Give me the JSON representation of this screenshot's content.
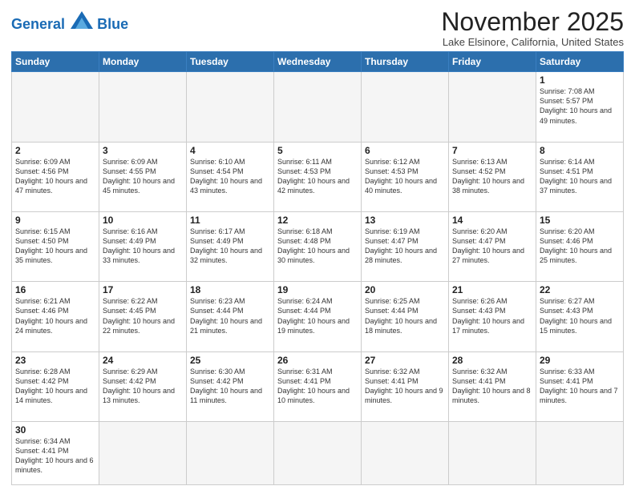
{
  "header": {
    "logo_general": "General",
    "logo_blue": "Blue",
    "month": "November 2025",
    "location": "Lake Elsinore, California, United States"
  },
  "days_of_week": [
    "Sunday",
    "Monday",
    "Tuesday",
    "Wednesday",
    "Thursday",
    "Friday",
    "Saturday"
  ],
  "weeks": [
    [
      {
        "num": "",
        "info": ""
      },
      {
        "num": "",
        "info": ""
      },
      {
        "num": "",
        "info": ""
      },
      {
        "num": "",
        "info": ""
      },
      {
        "num": "",
        "info": ""
      },
      {
        "num": "",
        "info": ""
      },
      {
        "num": "1",
        "info": "Sunrise: 7:08 AM\nSunset: 5:57 PM\nDaylight: 10 hours and 49 minutes."
      }
    ],
    [
      {
        "num": "2",
        "info": "Sunrise: 6:09 AM\nSunset: 4:56 PM\nDaylight: 10 hours and 47 minutes."
      },
      {
        "num": "3",
        "info": "Sunrise: 6:09 AM\nSunset: 4:55 PM\nDaylight: 10 hours and 45 minutes."
      },
      {
        "num": "4",
        "info": "Sunrise: 6:10 AM\nSunset: 4:54 PM\nDaylight: 10 hours and 43 minutes."
      },
      {
        "num": "5",
        "info": "Sunrise: 6:11 AM\nSunset: 4:53 PM\nDaylight: 10 hours and 42 minutes."
      },
      {
        "num": "6",
        "info": "Sunrise: 6:12 AM\nSunset: 4:53 PM\nDaylight: 10 hours and 40 minutes."
      },
      {
        "num": "7",
        "info": "Sunrise: 6:13 AM\nSunset: 4:52 PM\nDaylight: 10 hours and 38 minutes."
      },
      {
        "num": "8",
        "info": "Sunrise: 6:14 AM\nSunset: 4:51 PM\nDaylight: 10 hours and 37 minutes."
      }
    ],
    [
      {
        "num": "9",
        "info": "Sunrise: 6:15 AM\nSunset: 4:50 PM\nDaylight: 10 hours and 35 minutes."
      },
      {
        "num": "10",
        "info": "Sunrise: 6:16 AM\nSunset: 4:49 PM\nDaylight: 10 hours and 33 minutes."
      },
      {
        "num": "11",
        "info": "Sunrise: 6:17 AM\nSunset: 4:49 PM\nDaylight: 10 hours and 32 minutes."
      },
      {
        "num": "12",
        "info": "Sunrise: 6:18 AM\nSunset: 4:48 PM\nDaylight: 10 hours and 30 minutes."
      },
      {
        "num": "13",
        "info": "Sunrise: 6:19 AM\nSunset: 4:47 PM\nDaylight: 10 hours and 28 minutes."
      },
      {
        "num": "14",
        "info": "Sunrise: 6:20 AM\nSunset: 4:47 PM\nDaylight: 10 hours and 27 minutes."
      },
      {
        "num": "15",
        "info": "Sunrise: 6:20 AM\nSunset: 4:46 PM\nDaylight: 10 hours and 25 minutes."
      }
    ],
    [
      {
        "num": "16",
        "info": "Sunrise: 6:21 AM\nSunset: 4:46 PM\nDaylight: 10 hours and 24 minutes."
      },
      {
        "num": "17",
        "info": "Sunrise: 6:22 AM\nSunset: 4:45 PM\nDaylight: 10 hours and 22 minutes."
      },
      {
        "num": "18",
        "info": "Sunrise: 6:23 AM\nSunset: 4:44 PM\nDaylight: 10 hours and 21 minutes."
      },
      {
        "num": "19",
        "info": "Sunrise: 6:24 AM\nSunset: 4:44 PM\nDaylight: 10 hours and 19 minutes."
      },
      {
        "num": "20",
        "info": "Sunrise: 6:25 AM\nSunset: 4:44 PM\nDaylight: 10 hours and 18 minutes."
      },
      {
        "num": "21",
        "info": "Sunrise: 6:26 AM\nSunset: 4:43 PM\nDaylight: 10 hours and 17 minutes."
      },
      {
        "num": "22",
        "info": "Sunrise: 6:27 AM\nSunset: 4:43 PM\nDaylight: 10 hours and 15 minutes."
      }
    ],
    [
      {
        "num": "23",
        "info": "Sunrise: 6:28 AM\nSunset: 4:42 PM\nDaylight: 10 hours and 14 minutes."
      },
      {
        "num": "24",
        "info": "Sunrise: 6:29 AM\nSunset: 4:42 PM\nDaylight: 10 hours and 13 minutes."
      },
      {
        "num": "25",
        "info": "Sunrise: 6:30 AM\nSunset: 4:42 PM\nDaylight: 10 hours and 11 minutes."
      },
      {
        "num": "26",
        "info": "Sunrise: 6:31 AM\nSunset: 4:41 PM\nDaylight: 10 hours and 10 minutes."
      },
      {
        "num": "27",
        "info": "Sunrise: 6:32 AM\nSunset: 4:41 PM\nDaylight: 10 hours and 9 minutes."
      },
      {
        "num": "28",
        "info": "Sunrise: 6:32 AM\nSunset: 4:41 PM\nDaylight: 10 hours and 8 minutes."
      },
      {
        "num": "29",
        "info": "Sunrise: 6:33 AM\nSunset: 4:41 PM\nDaylight: 10 hours and 7 minutes."
      }
    ],
    [
      {
        "num": "30",
        "info": "Sunrise: 6:34 AM\nSunset: 4:41 PM\nDaylight: 10 hours and 6 minutes."
      },
      {
        "num": "",
        "info": ""
      },
      {
        "num": "",
        "info": ""
      },
      {
        "num": "",
        "info": ""
      },
      {
        "num": "",
        "info": ""
      },
      {
        "num": "",
        "info": ""
      },
      {
        "num": "",
        "info": ""
      }
    ]
  ]
}
